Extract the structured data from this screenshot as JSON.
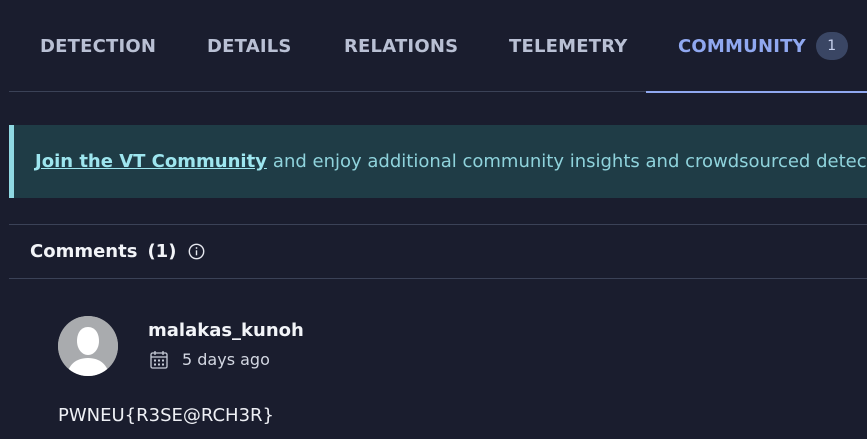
{
  "tabs": [
    {
      "label": "DETECTION"
    },
    {
      "label": "DETAILS"
    },
    {
      "label": "RELATIONS"
    },
    {
      "label": "TELEMETRY"
    },
    {
      "label": "COMMUNITY",
      "badge": "1",
      "active": true
    }
  ],
  "banner": {
    "link_text": "Join the VT Community",
    "text": "and enjoy additional community insights and crowdsourced detection"
  },
  "comments": {
    "title": "Comments",
    "count": "(1)",
    "items": [
      {
        "username": "malakas_kunoh",
        "date": "5 days ago",
        "body": "PWNEU{R3SE@RCH3R}"
      }
    ]
  },
  "icons": {
    "info": "info-icon",
    "calendar": "calendar-icon",
    "avatar": "user-avatar-icon"
  },
  "colors": {
    "background": "#1a1d2e",
    "active_tab": "#90a8f0",
    "banner_bg": "#1f3c46",
    "banner_accent": "#8fd9e3"
  }
}
